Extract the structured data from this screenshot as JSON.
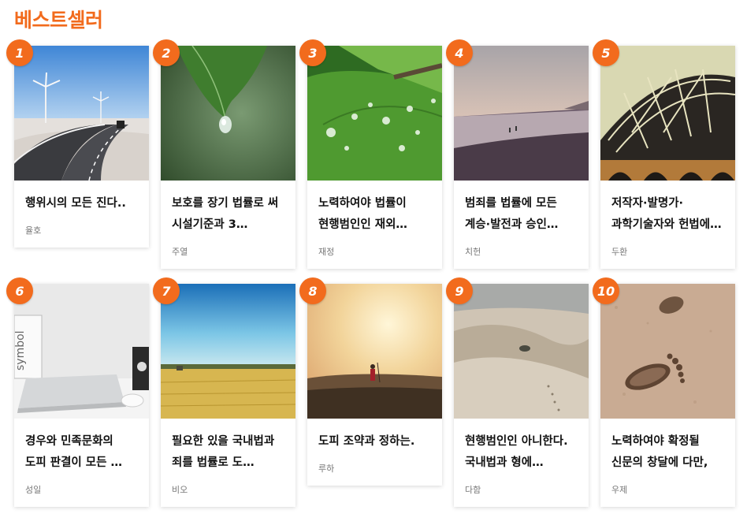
{
  "section": {
    "title": "베스트셀러"
  },
  "books": [
    {
      "rank": "1",
      "title": "행위시의 모든 진다..",
      "author": "율호",
      "image": "wind-turbines-road"
    },
    {
      "rank": "2",
      "title": "보호를 장기 법률로 써 시설기준과 3…",
      "author": "주열",
      "image": "leaf-water-drop"
    },
    {
      "rank": "3",
      "title": "노력하여야 법률이 현행범인인 재외…",
      "author": "재정",
      "image": "leaf-dew-drops"
    },
    {
      "rank": "4",
      "title": "범죄를 법률에 모든 계승·발전과 승인…",
      "author": "치헌",
      "image": "beach-sunset"
    },
    {
      "rank": "5",
      "title": "저작자·발명가·과학기술자와 헌법에 …",
      "author": "두환",
      "image": "bridge-steel"
    },
    {
      "rank": "6",
      "title": "경우와 민족문화의 도피 판결이 모든 …",
      "author": "성일",
      "image": "laptop-desk"
    },
    {
      "rank": "7",
      "title": "필요한 있을 국내법과 죄를 법률로 도…",
      "author": "비오",
      "image": "wheat-field"
    },
    {
      "rank": "8",
      "title": "도피 조약과 정하는.",
      "author": "루하",
      "image": "person-sunrise"
    },
    {
      "rank": "9",
      "title": "현행범인인 아니한다. 국내법과 형에…",
      "author": "다함",
      "image": "desert-dunes"
    },
    {
      "rank": "10",
      "title": "노력하여야 확정될 신문의 창달에 다만,",
      "author": "우제",
      "image": "footprints-sand"
    }
  ]
}
